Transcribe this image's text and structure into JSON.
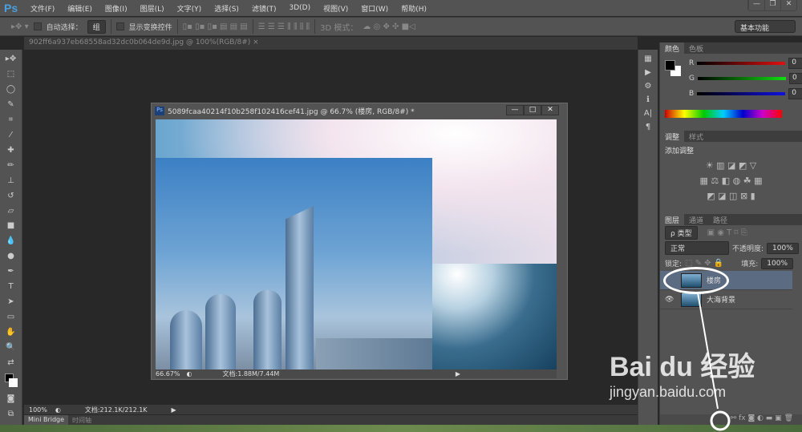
{
  "app": {
    "logo": "Ps",
    "menus": [
      "文件(F)",
      "编辑(E)",
      "图像(I)",
      "图层(L)",
      "文字(Y)",
      "选择(S)",
      "滤镜(T)",
      "3D(D)",
      "视图(V)",
      "窗口(W)",
      "帮助(H)"
    ],
    "window_controls": [
      "—",
      "❐",
      "✕"
    ]
  },
  "options": {
    "auto_select_label": "自动选择：",
    "auto_select_value": "组",
    "show_transform_label": "显示变换控件",
    "mode_3d_label": "3D 模式：",
    "workspace": "基本功能"
  },
  "doc_tab": {
    "title": "902ff6a937eb68558ad32dc0b064de9d.jpg @ 100%(RGB/8#)",
    "close": "×"
  },
  "image_window": {
    "title": "5089fcaa40214f10b258f102416cef41.jpg @ 66.7% (楼房, RGB/8#) *",
    "zoom": "66.67%",
    "doc_size": "文档:1.88M/7.44M",
    "ps_icon": "Ps"
  },
  "bottom_status": {
    "zoom": "100%",
    "doc_size": "文档:212.1K/212.1K"
  },
  "bottom_tabs": [
    "Mini Bridge",
    "时间轴"
  ],
  "color_panel": {
    "tabs": [
      "颜色",
      "色板"
    ],
    "channels": [
      {
        "label": "R",
        "value": "0",
        "color": "#e01010"
      },
      {
        "label": "G",
        "value": "0",
        "color": "#10e010"
      },
      {
        "label": "B",
        "value": "0",
        "color": "#1010e0"
      }
    ]
  },
  "adjust_panel": {
    "tabs": [
      "调整",
      "样式"
    ],
    "heading": "添加调整"
  },
  "layers_panel": {
    "tabs": [
      "图层",
      "通道",
      "路径"
    ],
    "filter": "ρ 类型",
    "blend_mode": "正常",
    "opacity_label": "不透明度:",
    "opacity": "100%",
    "lock_label": "锁定:",
    "fill_label": "填充:",
    "fill": "100%",
    "layers": [
      {
        "name": "楼房",
        "selected": true,
        "visible": false
      },
      {
        "name": "大海背景",
        "selected": false,
        "visible": true
      }
    ]
  },
  "watermark": {
    "brand": "Bai du 经验",
    "url": "jingyan.baidu.com"
  }
}
